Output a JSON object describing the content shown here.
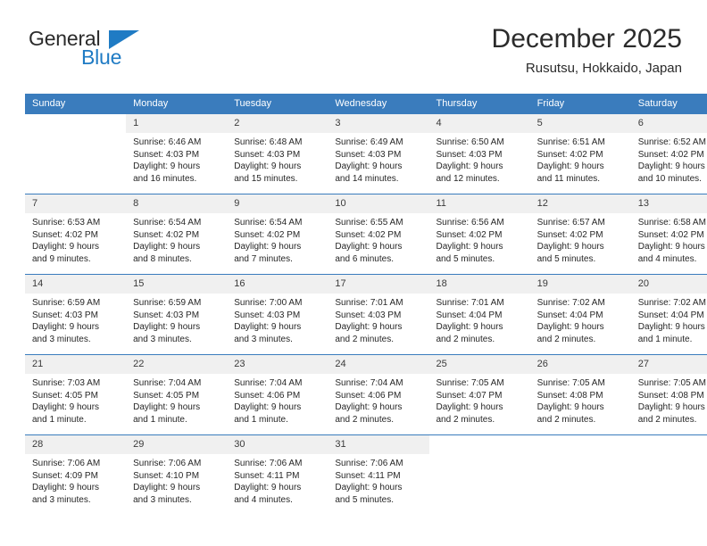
{
  "brand": {
    "name_part1": "General",
    "name_part2": "Blue",
    "triangle_color": "#1f7bc4",
    "text_color": "#2b2b2b"
  },
  "header": {
    "title": "December 2025",
    "subtitle": "Rusutsu, Hokkaido, Japan"
  },
  "theme": {
    "header_bg": "#3a7cbd",
    "header_text": "#ffffff",
    "daynum_bg": "#f0f0f0",
    "grid_line": "#3a7cbd"
  },
  "weekdays": [
    "Sunday",
    "Monday",
    "Tuesday",
    "Wednesday",
    "Thursday",
    "Friday",
    "Saturday"
  ],
  "weeks": [
    [
      {
        "day": "",
        "sunrise": "",
        "sunset": "",
        "daylight_line1": "",
        "daylight_line2": ""
      },
      {
        "day": "1",
        "sunrise": "Sunrise: 6:46 AM",
        "sunset": "Sunset: 4:03 PM",
        "daylight_line1": "Daylight: 9 hours",
        "daylight_line2": "and 16 minutes."
      },
      {
        "day": "2",
        "sunrise": "Sunrise: 6:48 AM",
        "sunset": "Sunset: 4:03 PM",
        "daylight_line1": "Daylight: 9 hours",
        "daylight_line2": "and 15 minutes."
      },
      {
        "day": "3",
        "sunrise": "Sunrise: 6:49 AM",
        "sunset": "Sunset: 4:03 PM",
        "daylight_line1": "Daylight: 9 hours",
        "daylight_line2": "and 14 minutes."
      },
      {
        "day": "4",
        "sunrise": "Sunrise: 6:50 AM",
        "sunset": "Sunset: 4:03 PM",
        "daylight_line1": "Daylight: 9 hours",
        "daylight_line2": "and 12 minutes."
      },
      {
        "day": "5",
        "sunrise": "Sunrise: 6:51 AM",
        "sunset": "Sunset: 4:02 PM",
        "daylight_line1": "Daylight: 9 hours",
        "daylight_line2": "and 11 minutes."
      },
      {
        "day": "6",
        "sunrise": "Sunrise: 6:52 AM",
        "sunset": "Sunset: 4:02 PM",
        "daylight_line1": "Daylight: 9 hours",
        "daylight_line2": "and 10 minutes."
      }
    ],
    [
      {
        "day": "7",
        "sunrise": "Sunrise: 6:53 AM",
        "sunset": "Sunset: 4:02 PM",
        "daylight_line1": "Daylight: 9 hours",
        "daylight_line2": "and 9 minutes."
      },
      {
        "day": "8",
        "sunrise": "Sunrise: 6:54 AM",
        "sunset": "Sunset: 4:02 PM",
        "daylight_line1": "Daylight: 9 hours",
        "daylight_line2": "and 8 minutes."
      },
      {
        "day": "9",
        "sunrise": "Sunrise: 6:54 AM",
        "sunset": "Sunset: 4:02 PM",
        "daylight_line1": "Daylight: 9 hours",
        "daylight_line2": "and 7 minutes."
      },
      {
        "day": "10",
        "sunrise": "Sunrise: 6:55 AM",
        "sunset": "Sunset: 4:02 PM",
        "daylight_line1": "Daylight: 9 hours",
        "daylight_line2": "and 6 minutes."
      },
      {
        "day": "11",
        "sunrise": "Sunrise: 6:56 AM",
        "sunset": "Sunset: 4:02 PM",
        "daylight_line1": "Daylight: 9 hours",
        "daylight_line2": "and 5 minutes."
      },
      {
        "day": "12",
        "sunrise": "Sunrise: 6:57 AM",
        "sunset": "Sunset: 4:02 PM",
        "daylight_line1": "Daylight: 9 hours",
        "daylight_line2": "and 5 minutes."
      },
      {
        "day": "13",
        "sunrise": "Sunrise: 6:58 AM",
        "sunset": "Sunset: 4:02 PM",
        "daylight_line1": "Daylight: 9 hours",
        "daylight_line2": "and 4 minutes."
      }
    ],
    [
      {
        "day": "14",
        "sunrise": "Sunrise: 6:59 AM",
        "sunset": "Sunset: 4:03 PM",
        "daylight_line1": "Daylight: 9 hours",
        "daylight_line2": "and 3 minutes."
      },
      {
        "day": "15",
        "sunrise": "Sunrise: 6:59 AM",
        "sunset": "Sunset: 4:03 PM",
        "daylight_line1": "Daylight: 9 hours",
        "daylight_line2": "and 3 minutes."
      },
      {
        "day": "16",
        "sunrise": "Sunrise: 7:00 AM",
        "sunset": "Sunset: 4:03 PM",
        "daylight_line1": "Daylight: 9 hours",
        "daylight_line2": "and 3 minutes."
      },
      {
        "day": "17",
        "sunrise": "Sunrise: 7:01 AM",
        "sunset": "Sunset: 4:03 PM",
        "daylight_line1": "Daylight: 9 hours",
        "daylight_line2": "and 2 minutes."
      },
      {
        "day": "18",
        "sunrise": "Sunrise: 7:01 AM",
        "sunset": "Sunset: 4:04 PM",
        "daylight_line1": "Daylight: 9 hours",
        "daylight_line2": "and 2 minutes."
      },
      {
        "day": "19",
        "sunrise": "Sunrise: 7:02 AM",
        "sunset": "Sunset: 4:04 PM",
        "daylight_line1": "Daylight: 9 hours",
        "daylight_line2": "and 2 minutes."
      },
      {
        "day": "20",
        "sunrise": "Sunrise: 7:02 AM",
        "sunset": "Sunset: 4:04 PM",
        "daylight_line1": "Daylight: 9 hours",
        "daylight_line2": "and 1 minute."
      }
    ],
    [
      {
        "day": "21",
        "sunrise": "Sunrise: 7:03 AM",
        "sunset": "Sunset: 4:05 PM",
        "daylight_line1": "Daylight: 9 hours",
        "daylight_line2": "and 1 minute."
      },
      {
        "day": "22",
        "sunrise": "Sunrise: 7:04 AM",
        "sunset": "Sunset: 4:05 PM",
        "daylight_line1": "Daylight: 9 hours",
        "daylight_line2": "and 1 minute."
      },
      {
        "day": "23",
        "sunrise": "Sunrise: 7:04 AM",
        "sunset": "Sunset: 4:06 PM",
        "daylight_line1": "Daylight: 9 hours",
        "daylight_line2": "and 1 minute."
      },
      {
        "day": "24",
        "sunrise": "Sunrise: 7:04 AM",
        "sunset": "Sunset: 4:06 PM",
        "daylight_line1": "Daylight: 9 hours",
        "daylight_line2": "and 2 minutes."
      },
      {
        "day": "25",
        "sunrise": "Sunrise: 7:05 AM",
        "sunset": "Sunset: 4:07 PM",
        "daylight_line1": "Daylight: 9 hours",
        "daylight_line2": "and 2 minutes."
      },
      {
        "day": "26",
        "sunrise": "Sunrise: 7:05 AM",
        "sunset": "Sunset: 4:08 PM",
        "daylight_line1": "Daylight: 9 hours",
        "daylight_line2": "and 2 minutes."
      },
      {
        "day": "27",
        "sunrise": "Sunrise: 7:05 AM",
        "sunset": "Sunset: 4:08 PM",
        "daylight_line1": "Daylight: 9 hours",
        "daylight_line2": "and 2 minutes."
      }
    ],
    [
      {
        "day": "28",
        "sunrise": "Sunrise: 7:06 AM",
        "sunset": "Sunset: 4:09 PM",
        "daylight_line1": "Daylight: 9 hours",
        "daylight_line2": "and 3 minutes."
      },
      {
        "day": "29",
        "sunrise": "Sunrise: 7:06 AM",
        "sunset": "Sunset: 4:10 PM",
        "daylight_line1": "Daylight: 9 hours",
        "daylight_line2": "and 3 minutes."
      },
      {
        "day": "30",
        "sunrise": "Sunrise: 7:06 AM",
        "sunset": "Sunset: 4:11 PM",
        "daylight_line1": "Daylight: 9 hours",
        "daylight_line2": "and 4 minutes."
      },
      {
        "day": "31",
        "sunrise": "Sunrise: 7:06 AM",
        "sunset": "Sunset: 4:11 PM",
        "daylight_line1": "Daylight: 9 hours",
        "daylight_line2": "and 5 minutes."
      },
      {
        "day": "",
        "sunrise": "",
        "sunset": "",
        "daylight_line1": "",
        "daylight_line2": ""
      },
      {
        "day": "",
        "sunrise": "",
        "sunset": "",
        "daylight_line1": "",
        "daylight_line2": ""
      },
      {
        "day": "",
        "sunrise": "",
        "sunset": "",
        "daylight_line1": "",
        "daylight_line2": ""
      }
    ]
  ]
}
